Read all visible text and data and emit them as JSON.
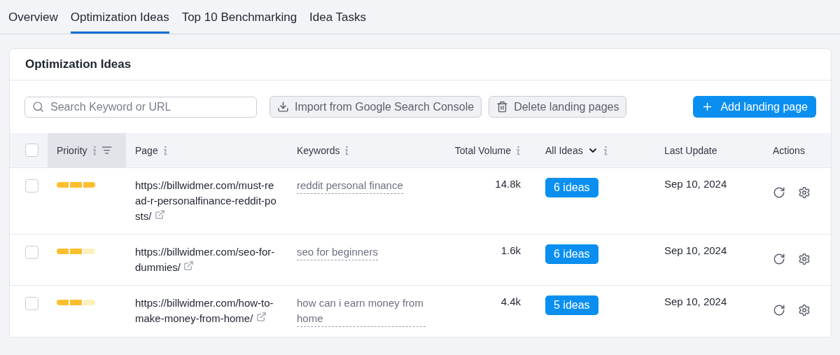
{
  "tabs": [
    {
      "label": "Overview",
      "selected": false
    },
    {
      "label": "Optimization Ideas",
      "selected": true
    },
    {
      "label": "Top 10 Benchmarking",
      "selected": false
    },
    {
      "label": "Idea Tasks",
      "selected": false
    }
  ],
  "panel": {
    "title": "Optimization Ideas"
  },
  "toolbar": {
    "search": {
      "placeholder": "Search Keyword or URL"
    },
    "import_button": "Import from Google Search Console",
    "delete_button": "Delete landing pages",
    "add_button": "Add landing page"
  },
  "table": {
    "columns": [
      {
        "label": "Priority",
        "info": true,
        "sortable": true,
        "sorted": true
      },
      {
        "label": "Page",
        "info": true
      },
      {
        "label": "Keywords",
        "info": true
      },
      {
        "label": "Total Volume",
        "info": true
      },
      {
        "label": "All Ideas",
        "info": true,
        "dropdown": true
      },
      {
        "label": "Last Update"
      },
      {
        "label": "Actions"
      }
    ],
    "select_all": {
      "checked": false
    },
    "rows": [
      {
        "checked": false,
        "priority": {
          "level": 1
        },
        "page": "https://billwidmer.com/must-read-r-personalfinance-reddit-posts/",
        "keyword": "reddit personal finance",
        "volume": "14.8k",
        "ideas": "6 ideas",
        "updated": "Sep 10, 2024"
      },
      {
        "checked": false,
        "priority": {
          "level": 0.67
        },
        "page": "https://billwidmer.com/seo-for-dummies/",
        "keyword": "seo for beginners",
        "volume": "1.6k",
        "ideas": "6 ideas",
        "updated": "Sep 10, 2024"
      },
      {
        "checked": false,
        "priority": {
          "level": 0.67
        },
        "page": "https://billwidmer.com/how-to-make-money-from-home/",
        "keyword": "how can i earn money from home",
        "volume": "4.4k",
        "ideas": "5 ideas",
        "updated": "Sep 10, 2024"
      }
    ]
  }
}
